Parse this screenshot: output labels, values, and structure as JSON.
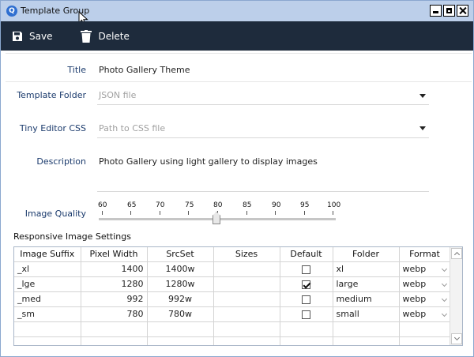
{
  "window": {
    "title": "Template Group",
    "app_icon_glyph": "Q"
  },
  "toolbar": {
    "save_label": "Save",
    "delete_label": "Delete"
  },
  "form": {
    "title": {
      "label": "Title",
      "value": "Photo Gallery Theme"
    },
    "template_folder": {
      "label": "Template Folder",
      "placeholder": "JSON file"
    },
    "tiny_editor_css": {
      "label": "Tiny Editor CSS",
      "placeholder": "Path to CSS file"
    },
    "description": {
      "label": "Description",
      "value": "Photo Gallery using light gallery to display images"
    },
    "image_quality": {
      "label": "Image Quality",
      "ticks": [
        "60",
        "65",
        "70",
        "75",
        "80",
        "85",
        "90",
        "95",
        "100"
      ],
      "value": 80
    }
  },
  "responsive": {
    "title": "Responsive Image Settings",
    "columns": [
      "Image Suffix",
      "Pixel Width",
      "SrcSet",
      "Sizes",
      "Default",
      "Folder",
      "Format"
    ],
    "rows": [
      {
        "suffix": "_xl",
        "width": "1400",
        "srcset": "1400w",
        "sizes": "",
        "default": false,
        "folder": "xl",
        "format": "webp"
      },
      {
        "suffix": "_lge",
        "width": "1280",
        "srcset": "1280w",
        "sizes": "",
        "default": true,
        "folder": "large",
        "format": "webp"
      },
      {
        "suffix": "_med",
        "width": "992",
        "srcset": "992w",
        "sizes": "",
        "default": false,
        "folder": "medium",
        "format": "webp"
      },
      {
        "suffix": "_sm",
        "width": "780",
        "srcset": "780w",
        "sizes": "",
        "default": false,
        "folder": "small",
        "format": "webp"
      }
    ]
  },
  "icons": {
    "save": "save-icon",
    "delete": "trash-icon",
    "dropdown": "chevron-down-icon"
  },
  "colors": {
    "titlebar": "#bccfea",
    "toolbar": "#1e2b3c",
    "label": "#1a3a6c",
    "app_icon": "#2f6fd0"
  }
}
